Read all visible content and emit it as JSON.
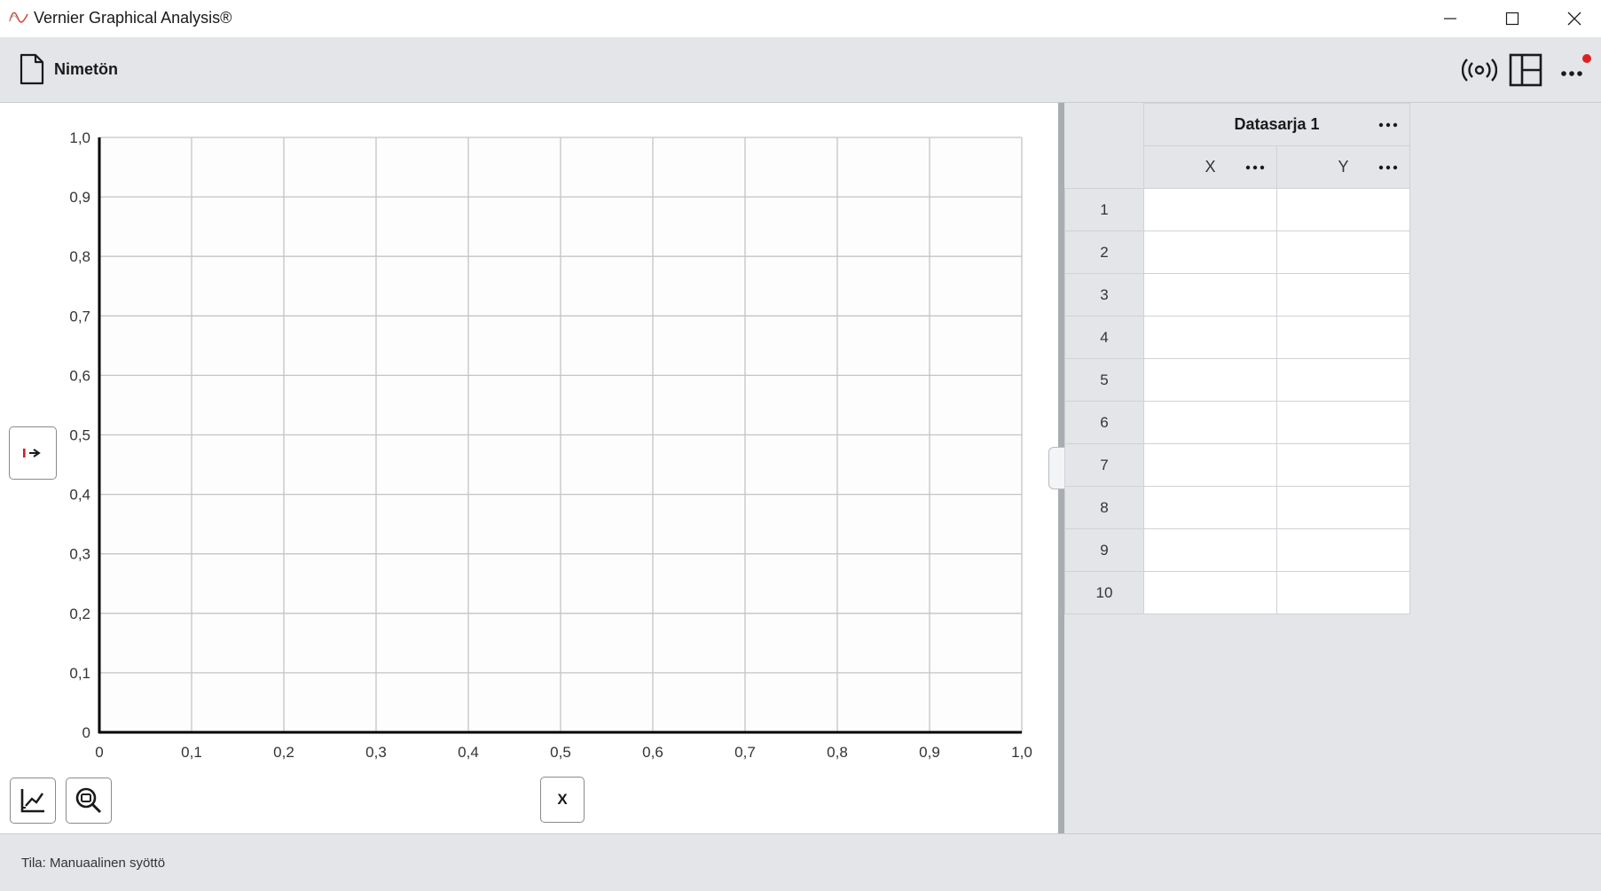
{
  "window": {
    "title": "Vernier Graphical Analysis®"
  },
  "toolbar": {
    "document_name": "Nimetön",
    "notification_color": "#e02020"
  },
  "graph": {
    "y_axis_button_icon": "y-axis-selector-icon",
    "x_axis_button_label": "X",
    "graph_options_icon": "graph-options-icon",
    "zoom_icon": "zoom-icon"
  },
  "chart_data": {
    "type": "scatter",
    "title": "",
    "xlabel": "",
    "ylabel": "",
    "xlim": [
      0,
      1.0
    ],
    "ylim": [
      0,
      1.0
    ],
    "grid": true,
    "x_ticks": [
      "0",
      "0,1",
      "0,2",
      "0,3",
      "0,4",
      "0,5",
      "0,6",
      "0,7",
      "0,8",
      "0,9",
      "1,0"
    ],
    "y_ticks": [
      "0",
      "0,1",
      "0,2",
      "0,3",
      "0,4",
      "0,5",
      "0,6",
      "0,7",
      "0,8",
      "0,9",
      "1,0"
    ],
    "series": []
  },
  "table": {
    "dataset_name": "Datasarja 1",
    "columns": [
      "X",
      "Y"
    ],
    "row_numbers": [
      "1",
      "2",
      "3",
      "4",
      "5",
      "6",
      "7",
      "8",
      "9",
      "10"
    ]
  },
  "status": {
    "text": "Tila: Manuaalinen syöttö"
  }
}
